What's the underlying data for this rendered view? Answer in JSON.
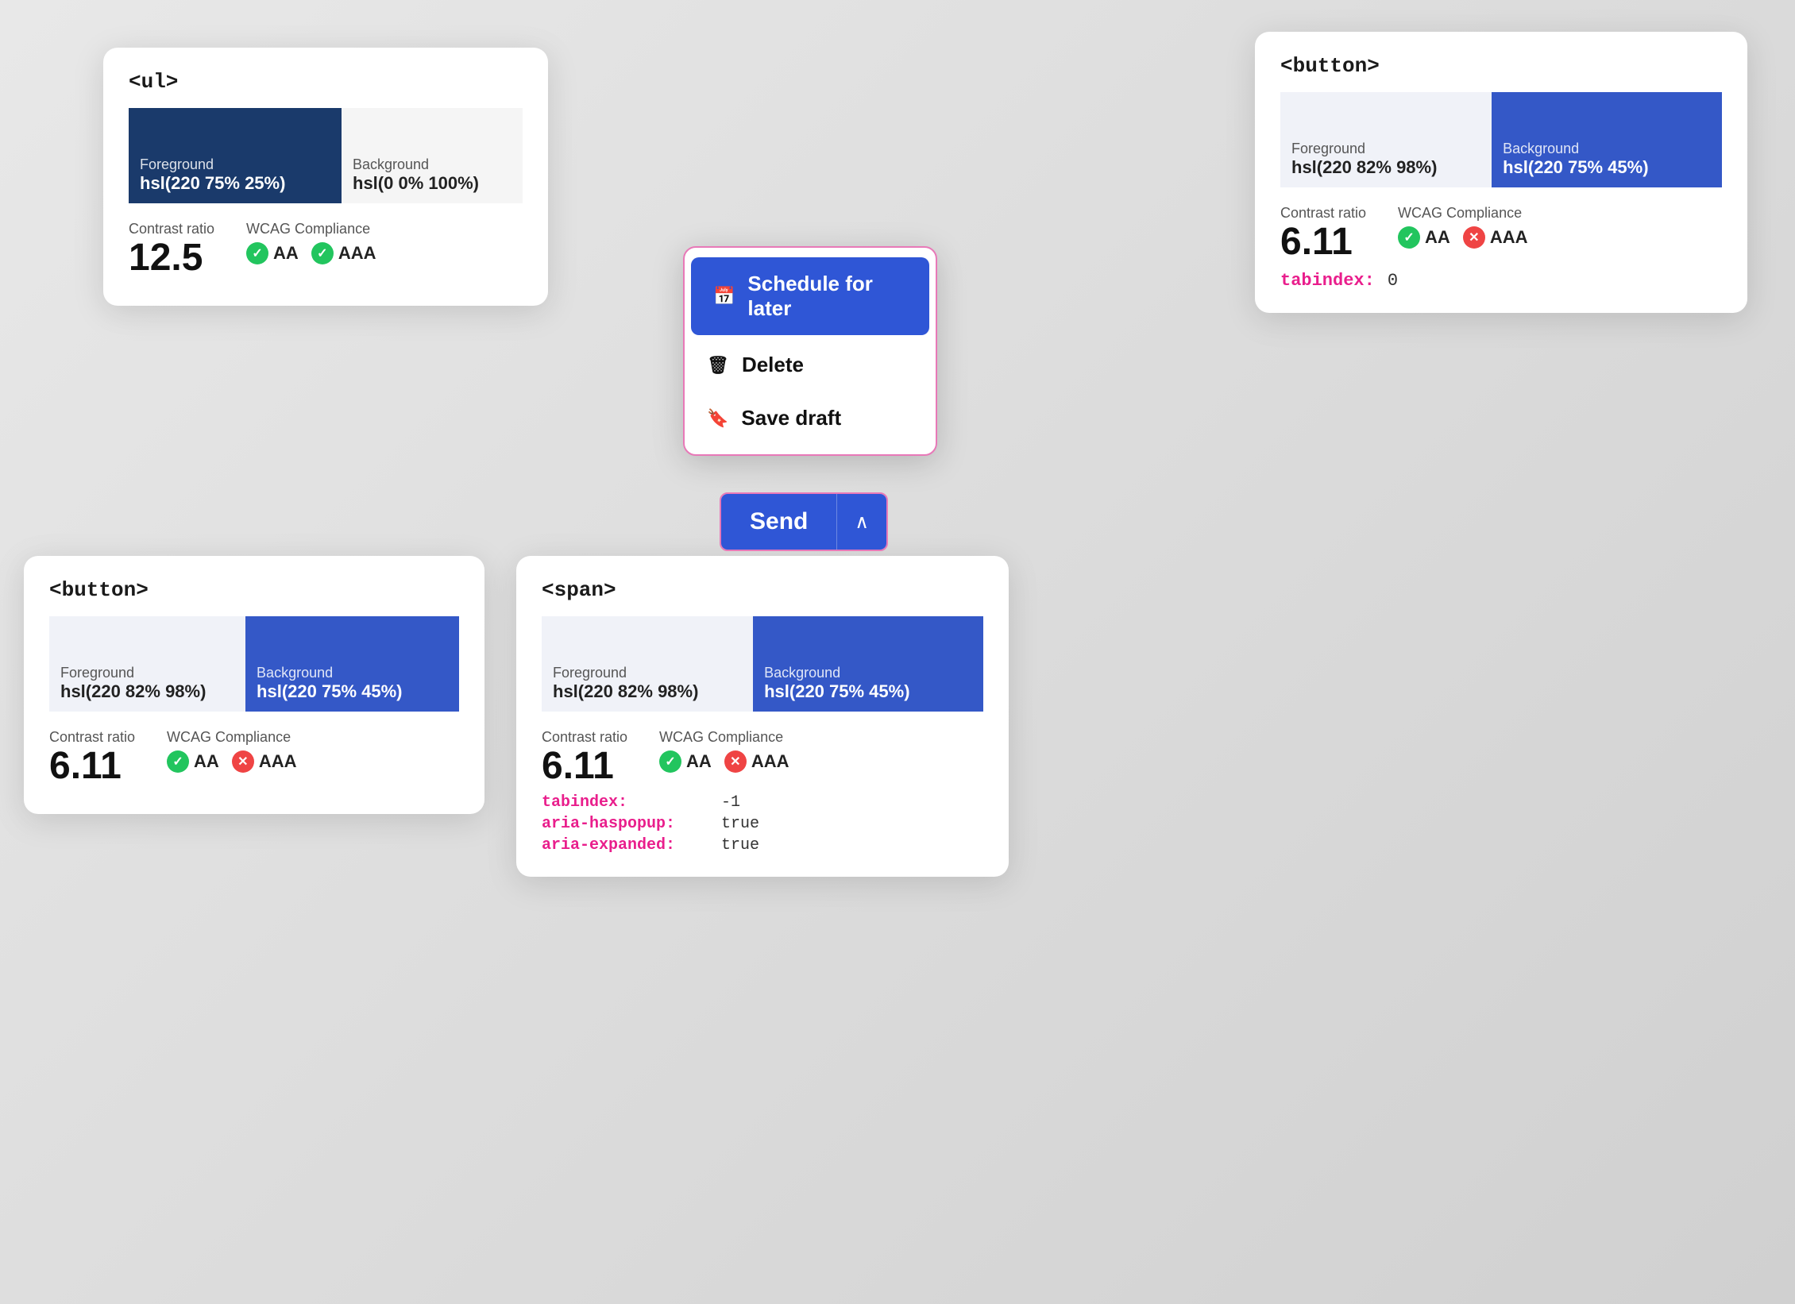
{
  "cards": {
    "ul_card": {
      "tag": "<ul>",
      "foreground_label": "Foreground",
      "foreground_value": "hsl(220 75% 25%)",
      "background_label": "Background",
      "background_value": "hsl(0 0% 100%)",
      "contrast_label": "Contrast ratio",
      "contrast_value": "12.5",
      "wcag_label": "WCAG Compliance",
      "aa_label": "AA",
      "aaa_label": "AAA",
      "aa_pass": true,
      "aaa_pass": true
    },
    "button_top_card": {
      "tag": "<button>",
      "foreground_label": "Foreground",
      "foreground_value": "hsl(220 82% 98%)",
      "background_label": "Background",
      "background_value": "hsl(220 75% 45%)",
      "contrast_label": "Contrast ratio",
      "contrast_value": "6.11",
      "wcag_label": "WCAG Compliance",
      "aa_label": "AA",
      "aaa_label": "AAA",
      "aa_pass": true,
      "aaa_pass": false,
      "tabindex_label": "tabindex:",
      "tabindex_value": "0"
    },
    "button_bottom_card": {
      "tag": "<button>",
      "foreground_label": "Foreground",
      "foreground_value": "hsl(220 82% 98%)",
      "background_label": "Background",
      "background_value": "hsl(220 75% 45%)",
      "contrast_label": "Contrast ratio",
      "contrast_value": "6.11",
      "wcag_label": "WCAG Compliance",
      "aa_label": "AA",
      "aaa_label": "AAA",
      "aa_pass": true,
      "aaa_pass": false
    },
    "span_card": {
      "tag": "<span>",
      "foreground_label": "Foreground",
      "foreground_value": "hsl(220 82% 98%)",
      "background_label": "Background",
      "background_value": "hsl(220 75% 45%)",
      "contrast_label": "Contrast ratio",
      "contrast_value": "6.11",
      "wcag_label": "WCAG Compliance",
      "aa_label": "AA",
      "aaa_label": "AAA",
      "aa_pass": true,
      "aaa_pass": false,
      "tabindex_label": "tabindex:",
      "tabindex_value": "-1",
      "aria_haspopup_label": "aria-haspopup:",
      "aria_haspopup_value": "true",
      "aria_expanded_label": "aria-expanded:",
      "aria_expanded_value": "true"
    }
  },
  "dropdown": {
    "schedule_label": "Schedule for later",
    "delete_label": "Delete",
    "save_draft_label": "Save draft"
  },
  "send_button": {
    "send_label": "Send",
    "chevron": "^"
  },
  "icons": {
    "calendar": "📅",
    "trash": "🗑",
    "bookmark": "🔖",
    "check": "✓",
    "x": "✕"
  }
}
